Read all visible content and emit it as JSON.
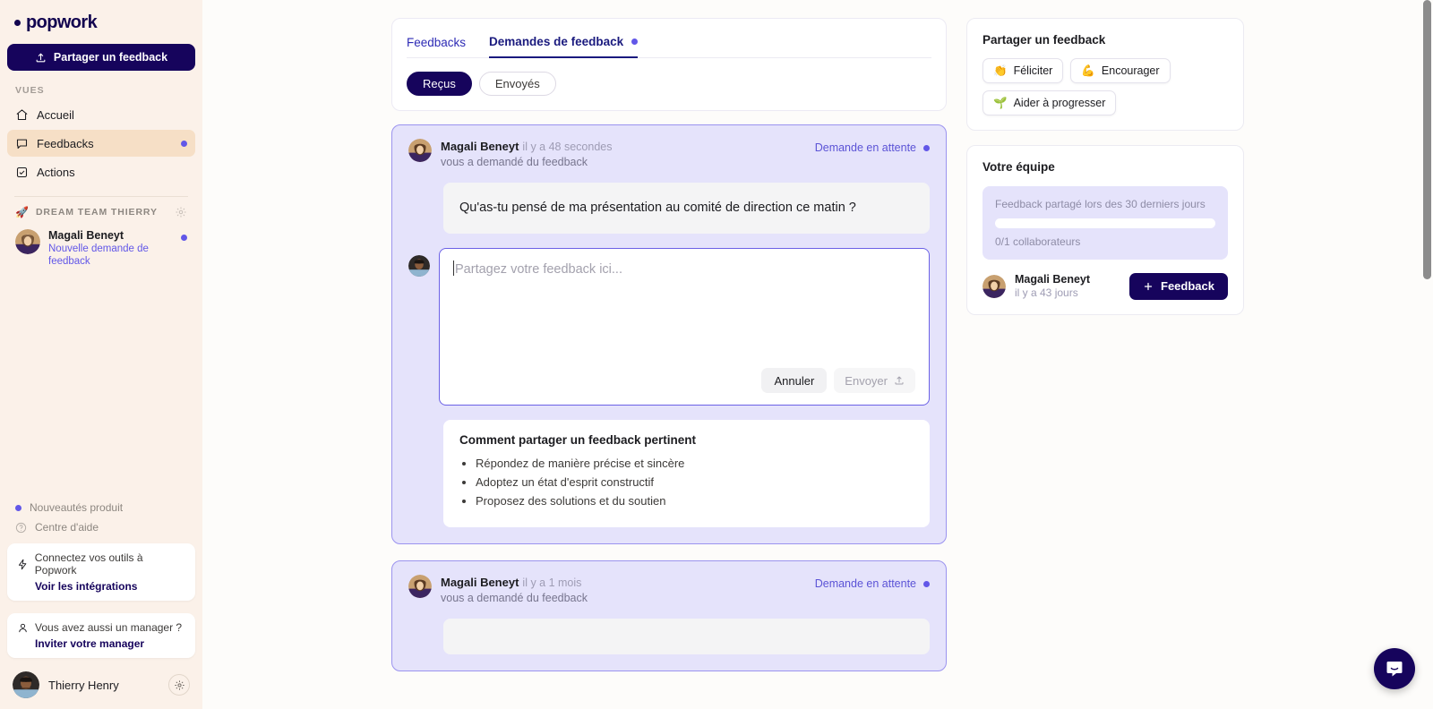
{
  "brand": {
    "name": "popwork",
    "accent": "#6257e8",
    "navy": "#16045c",
    "sidebar_bg": "#fbf1e9"
  },
  "sidebar": {
    "share_button": "Partager un feedback",
    "share_icon": "upload-icon",
    "views_label": "VUES",
    "items": [
      {
        "label": "Accueil",
        "icon": "home-icon",
        "active": false,
        "dot": false
      },
      {
        "label": "Feedbacks",
        "icon": "message-icon",
        "active": true,
        "dot": true
      },
      {
        "label": "Actions",
        "icon": "checkbox-icon",
        "active": false,
        "dot": false
      }
    ],
    "team": {
      "icon": "rocket-icon",
      "title": "DREAM TEAM THIERRY",
      "gear_icon": "gear-icon",
      "members": [
        {
          "name": "Magali Beneyt",
          "sub": "Nouvelle demande de feedback",
          "dot": true
        }
      ]
    },
    "mini_links": [
      {
        "label": "Nouveautés produit",
        "icon": "dot-icon"
      },
      {
        "label": "Centre d'aide",
        "icon": "question-circle-icon"
      }
    ],
    "promos": [
      {
        "icon": "bolt-icon",
        "text": "Connectez vos outils à Popwork",
        "link": "Voir les intégrations"
      },
      {
        "icon": "person-icon",
        "text": "Vous avez aussi un manager ?",
        "link": "Inviter votre manager"
      }
    ],
    "user": {
      "name": "Thierry Henry",
      "gear_icon": "gear-icon"
    }
  },
  "main": {
    "tabs": [
      {
        "label": "Feedbacks",
        "active": false,
        "dot": false
      },
      {
        "label": "Demandes de feedback",
        "active": true,
        "dot": true
      }
    ],
    "filters": [
      {
        "label": "Reçus",
        "selected": true
      },
      {
        "label": "Envoyés",
        "selected": false
      }
    ],
    "requests": [
      {
        "author": "Magali Beneyt",
        "time": "il y a 48 secondes",
        "action": "vous a demandé du feedback",
        "status": "Demande en attente",
        "question": "Qu'as-tu pensé de ma présentation au comité de direction ce matin ?",
        "composer": {
          "placeholder": "Partagez votre feedback ici...",
          "value": "",
          "cancel_label": "Annuler",
          "send_label": "Envoyer",
          "send_icon": "upload-icon"
        },
        "tips": {
          "title": "Comment partager un feedback pertinent",
          "items": [
            "Répondez de manière précise et sincère",
            "Adoptez un état d'esprit constructif",
            "Proposez des solutions et du soutien"
          ]
        }
      },
      {
        "author": "Magali Beneyt",
        "time": "il y a 1 mois",
        "action": "vous a demandé du feedback",
        "status": "Demande en attente"
      }
    ]
  },
  "right": {
    "share_panel": {
      "title": "Partager un feedback",
      "buttons": [
        {
          "label": "Féliciter",
          "emoji": "👏",
          "icon": "clap-icon"
        },
        {
          "label": "Encourager",
          "emoji": "💪",
          "icon": "muscle-icon"
        },
        {
          "label": "Aider à progresser",
          "emoji": "🌱",
          "icon": "seedling-icon"
        }
      ]
    },
    "team_panel": {
      "title": "Votre équipe",
      "stat_caption": "Feedback partagé lors des 30 derniers jours",
      "progress_percent": 0,
      "stat_sub": "0/1 collaborateurs",
      "members": [
        {
          "name": "Magali Beneyt",
          "time": "il y a 43 jours",
          "button": "Feedback",
          "button_icon": "plus-icon"
        }
      ]
    }
  },
  "widgets": {
    "intercom": "intercom-launcher",
    "intercom_icon": "chat-bubble-icon"
  }
}
